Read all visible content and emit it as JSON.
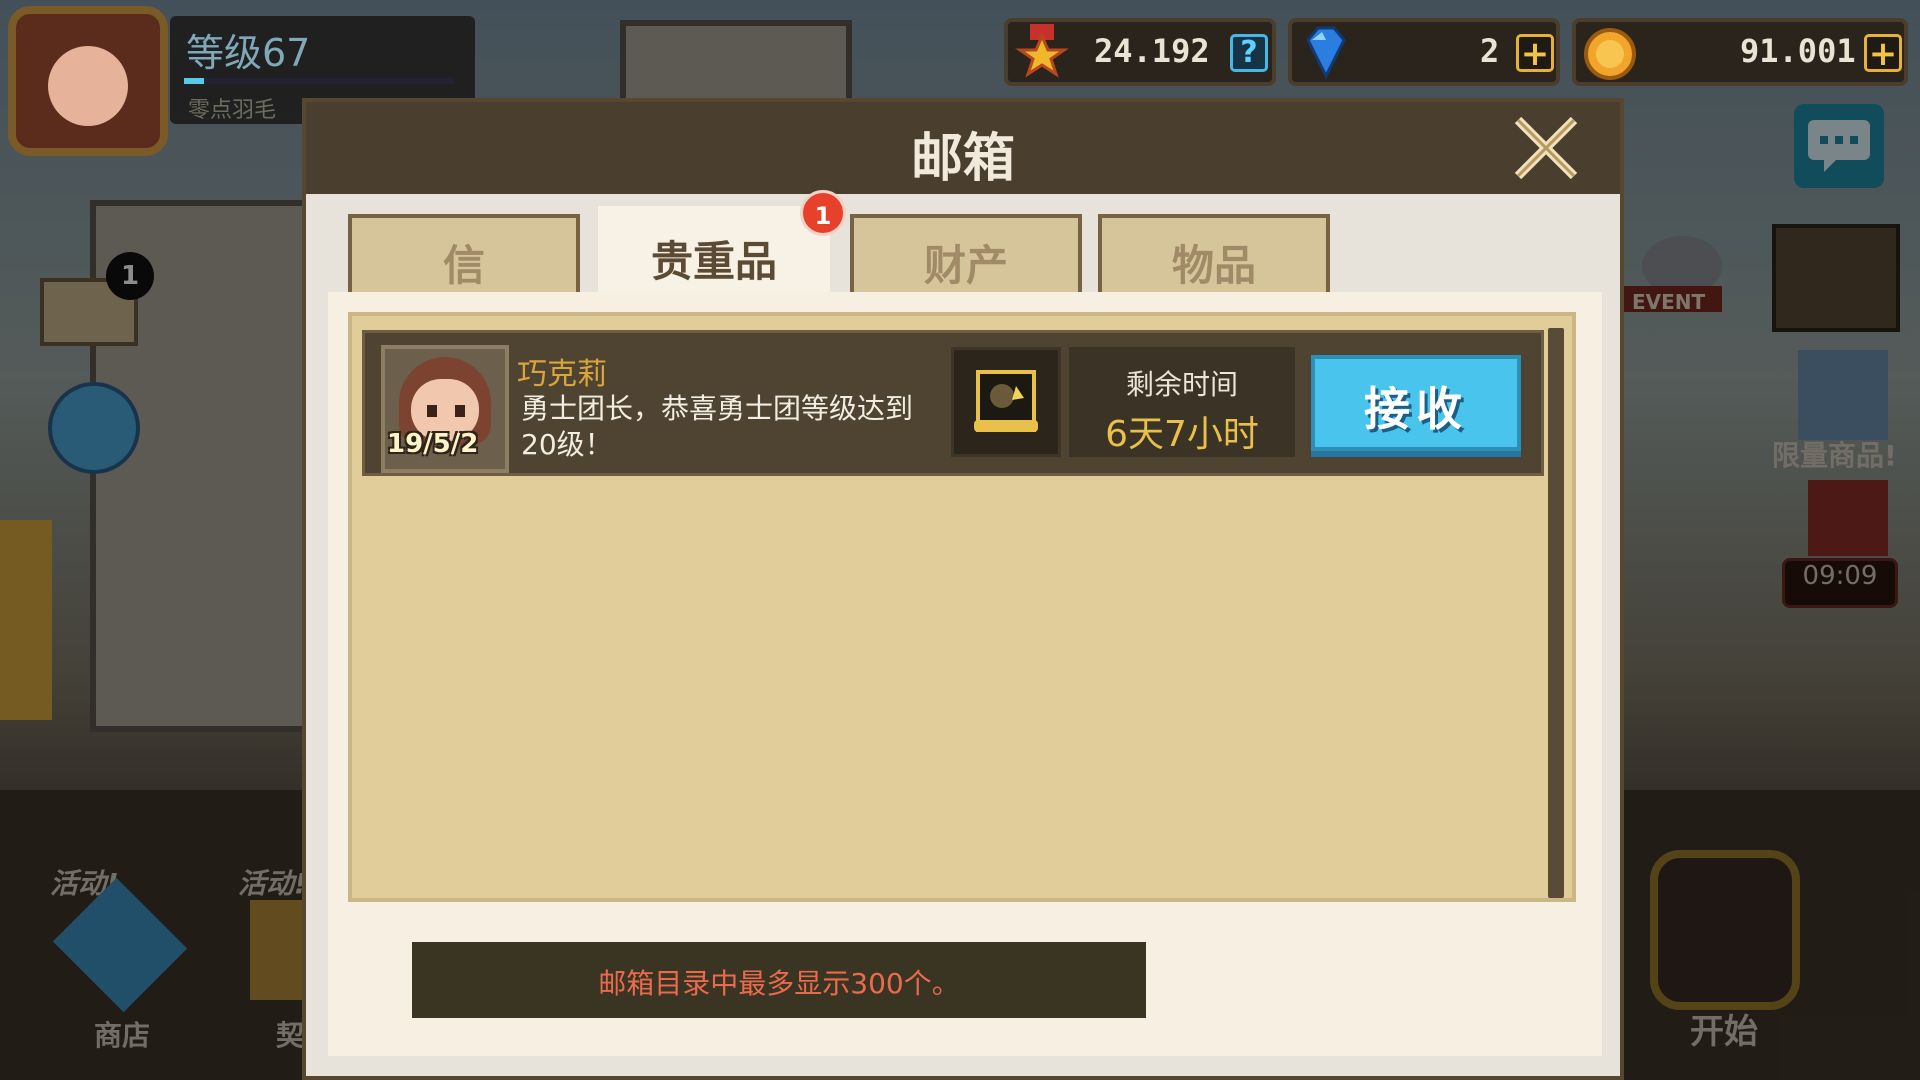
{
  "player": {
    "level_label": "等级67",
    "name": "零点羽毛"
  },
  "currencies": [
    {
      "icon": "medal-icon",
      "value": "24.192",
      "action": "help"
    },
    {
      "icon": "diamond-icon",
      "value": "2",
      "action": "add"
    },
    {
      "icon": "gold-coin-icon",
      "value": "91.001",
      "action": "add"
    }
  ],
  "background": {
    "notification_count": "1",
    "event_label": "EVENT",
    "limited_label": "限量商品!",
    "timer": "09:09",
    "activity_label_1": "活动!",
    "activity_label_2": "活动!",
    "shop_label": "商店",
    "contract_label": "契约",
    "start_label": "开始"
  },
  "mailbox": {
    "title": "邮箱",
    "tabs": [
      {
        "label": "信",
        "active": false
      },
      {
        "label": "贵重品",
        "active": true,
        "badge": "1"
      },
      {
        "label": "财产",
        "active": false
      },
      {
        "label": "物品",
        "active": false
      }
    ],
    "mails": [
      {
        "sender": "巧克莉",
        "date": "19/5/2",
        "message": "勇士团长，恭喜勇士团等级达到20级！",
        "item_icon": "scroll-icon",
        "time_label": "剩余时间",
        "time_value": "6天7小时",
        "button": "接收"
      }
    ],
    "notice": "邮箱目录中最多显示300个。"
  },
  "colors": {
    "header": "#4a3f2f",
    "tab_inactive": "#d6c59a",
    "list_bg": "#e0cd99",
    "mail_row": "#4f4431",
    "receive_button": "#49c4ec",
    "notice_text": "#ea6a4e",
    "time_value": "#e9c04a",
    "sender_name": "#d9a53c",
    "badge": "#e8412b"
  }
}
